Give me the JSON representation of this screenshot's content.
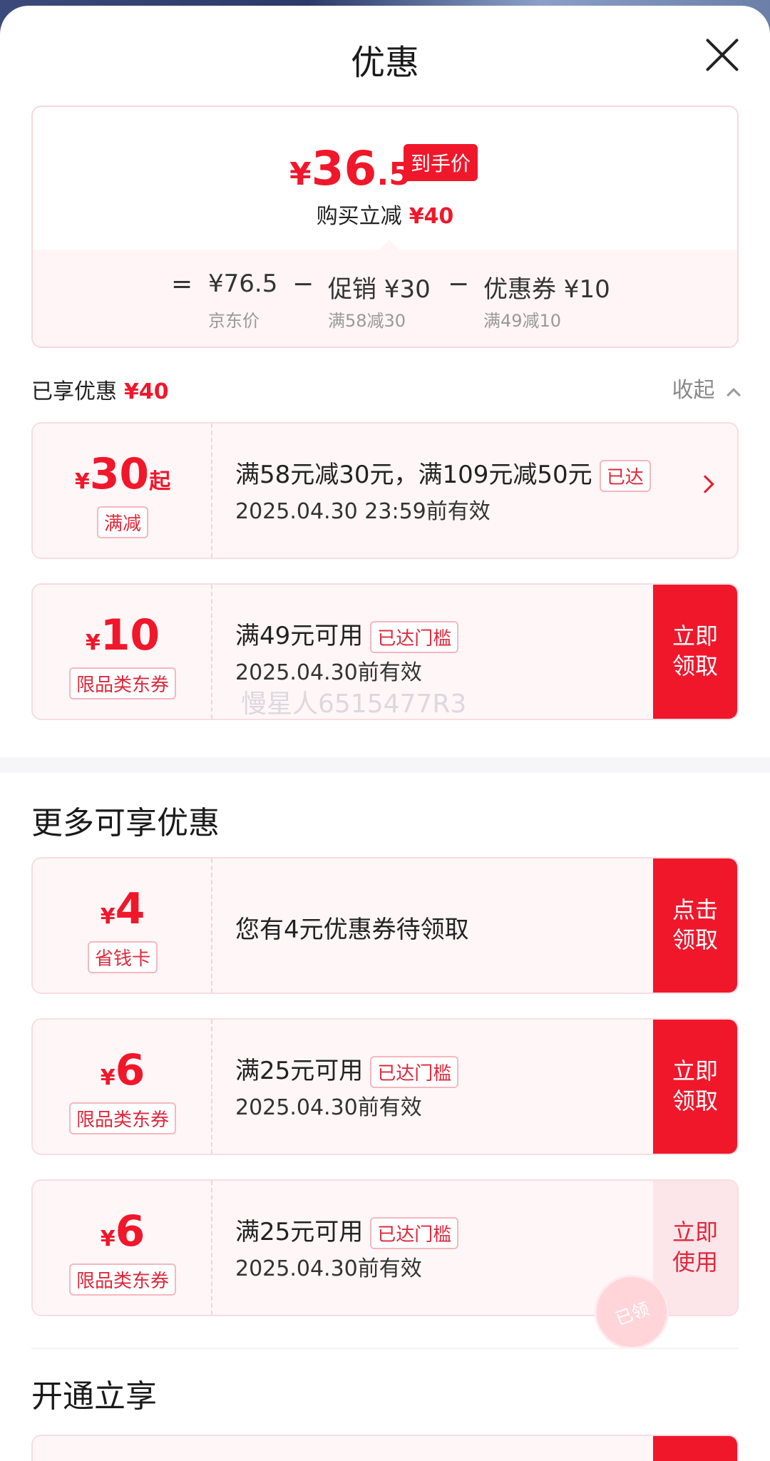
{
  "header": {
    "title": "优惠"
  },
  "summary": {
    "currency": "¥",
    "price_int": "36",
    "price_dec": ".5",
    "final_tag": "到手价",
    "reduce_label": "购买立减",
    "reduce_value": "¥40",
    "eq_sign": "=",
    "minus1": "−",
    "minus2": "−",
    "jd_price": "¥76.5",
    "jd_price_label": "京东价",
    "promo_value": "促销 ¥30",
    "promo_rule": "满58减30",
    "coupon_value": "优惠券 ¥10",
    "coupon_rule": "满49减10"
  },
  "enjoyed": {
    "label": "已享优惠",
    "value": "¥40",
    "collapse_label": "收起"
  },
  "cards": [
    {
      "currency": "¥",
      "amount": "30",
      "suffix": "起",
      "tag": "满减",
      "desc": "满58元减30元，满109元减50元",
      "badge": "已达",
      "date": "2025.04.30 23:59前有效"
    },
    {
      "currency": "¥",
      "amount": "10",
      "tag": "限品类东券",
      "desc": "满49元可用",
      "badge": "已达门槛",
      "date": "2025.04.30前有效",
      "action_line1": "立即",
      "action_line2": "领取"
    }
  ],
  "watermark": "慢星人6515477R3",
  "more_section": {
    "title": "更多可享优惠"
  },
  "more_cards": [
    {
      "currency": "¥",
      "amount": "4",
      "tag": "省钱卡",
      "desc": "您有4元优惠券待领取",
      "action_line1": "点击",
      "action_line2": "领取"
    },
    {
      "currency": "¥",
      "amount": "6",
      "tag": "限品类东券",
      "desc": "满25元可用",
      "badge": "已达门槛",
      "date": "2025.04.30前有效",
      "action_line1": "立即",
      "action_line2": "领取"
    },
    {
      "currency": "¥",
      "amount": "6",
      "tag": "限品类东券",
      "desc": "满25元可用",
      "badge": "已达门槛",
      "date": "2025.04.30前有效",
      "action_line1": "立即",
      "action_line2": "使用",
      "stamp": "已领"
    }
  ],
  "open_section": {
    "title": "开通立享"
  },
  "colors": {
    "accent": "#f0172b",
    "card_bg": "#fff6f7",
    "border": "#f8dde1"
  }
}
